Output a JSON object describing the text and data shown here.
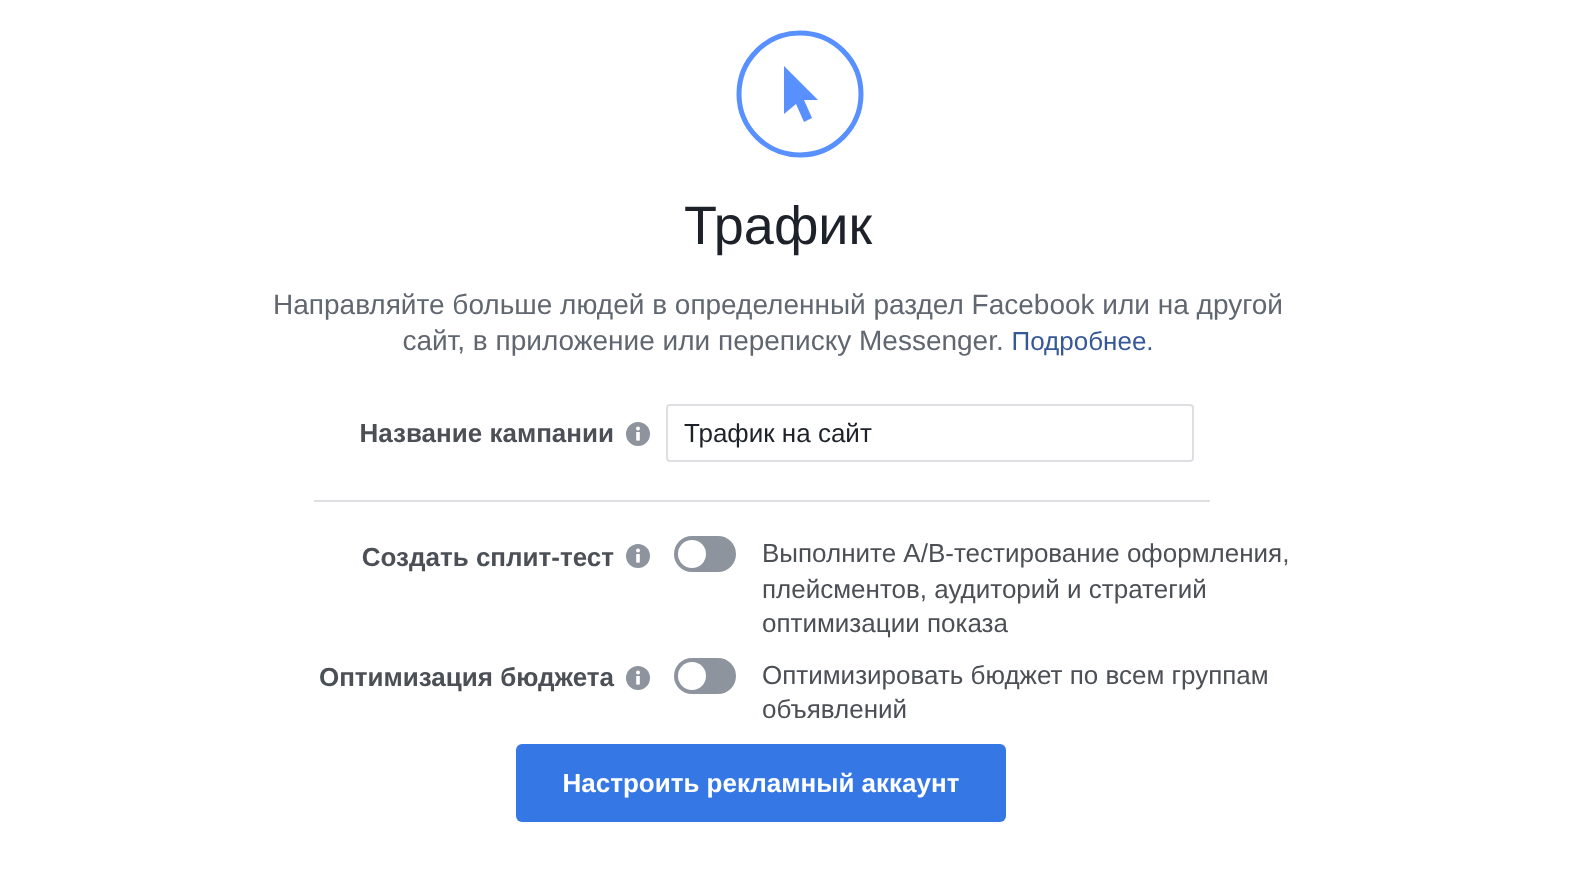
{
  "header": {
    "title": "Трафик",
    "description": "Направляйте больше людей в определенный раздел Facebook или на другой сайт, в приложение или переписку Messenger.",
    "link": "Подробнее."
  },
  "campaign_name": {
    "label": "Название кампании",
    "value": "Трафик на сайт"
  },
  "options": [
    {
      "label": "Создать сплит-тест",
      "on": false,
      "description": "Выполните A/B-тестирование оформления, плейсментов, аудиторий и стратегий оптимизации показа"
    },
    {
      "label": "Оптимизация бюджета",
      "on": false,
      "description": "Оптимизировать бюджет по всем группам объявлений"
    }
  ],
  "button": "Настроить рекламный аккаунт"
}
